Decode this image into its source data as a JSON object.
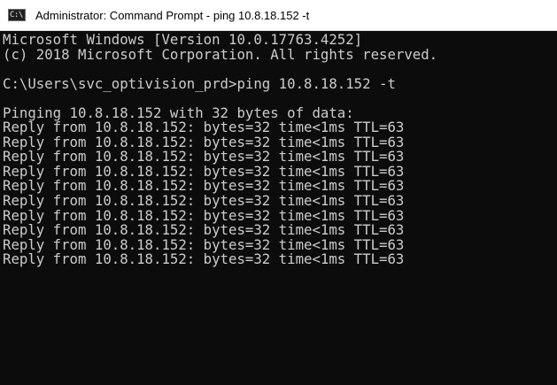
{
  "window": {
    "title": "Administrator: Command Prompt - ping  10.8.18.152 -t",
    "icon_name": "command-prompt-icon",
    "icon_glyph": "C:\\"
  },
  "console": {
    "text_color": "#cccccc",
    "background_color": "#0c0c0c",
    "lines": [
      "Microsoft Windows [Version 10.0.17763.4252]",
      "(c) 2018 Microsoft Corporation. All rights reserved.",
      "",
      "C:\\Users\\svc_optivision_prd>ping 10.8.18.152 -t",
      "",
      "Pinging 10.8.18.152 with 32 bytes of data:",
      "Reply from 10.8.18.152: bytes=32 time<1ms TTL=63",
      "Reply from 10.8.18.152: bytes=32 time<1ms TTL=63",
      "Reply from 10.8.18.152: bytes=32 time<1ms TTL=63",
      "Reply from 10.8.18.152: bytes=32 time<1ms TTL=63",
      "Reply from 10.8.18.152: bytes=32 time<1ms TTL=63",
      "Reply from 10.8.18.152: bytes=32 time<1ms TTL=63",
      "Reply from 10.8.18.152: bytes=32 time<1ms TTL=63",
      "Reply from 10.8.18.152: bytes=32 time<1ms TTL=63",
      "Reply from 10.8.18.152: bytes=32 time<1ms TTL=63",
      "Reply from 10.8.18.152: bytes=32 time<1ms TTL=63"
    ]
  }
}
